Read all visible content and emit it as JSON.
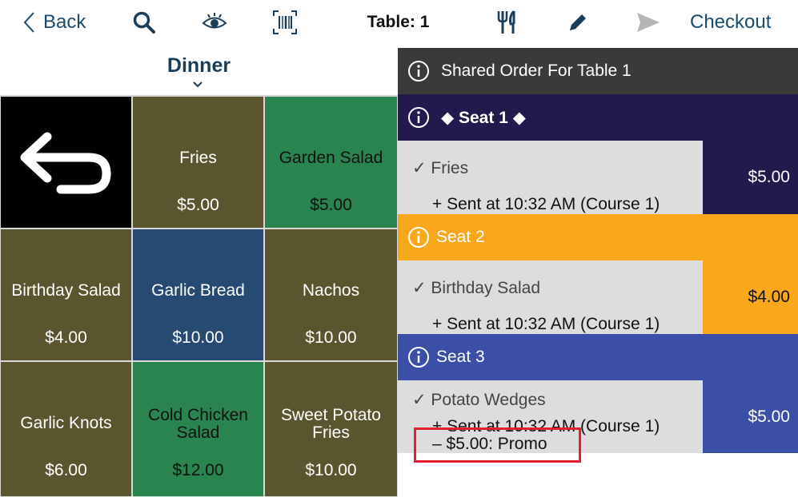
{
  "toolbar": {
    "back_label": "Back",
    "table_label": "Table: 1",
    "checkout_label": "Checkout"
  },
  "menu": {
    "title": "Dinner",
    "tiles": [
      {
        "name": "",
        "price": "",
        "color": "#000000"
      },
      {
        "name": "Fries",
        "price": "$5.00",
        "color": "#5b552f"
      },
      {
        "name": "Garden Salad",
        "price": "$5.00",
        "color": "#2a8450"
      },
      {
        "name": "Birthday Salad",
        "price": "$4.00",
        "color": "#5b552f"
      },
      {
        "name": "Garlic Bread",
        "price": "$10.00",
        "color": "#274a73"
      },
      {
        "name": "Nachos",
        "price": "$10.00",
        "color": "#5b552f"
      },
      {
        "name": "Garlic Knots",
        "price": "$6.00",
        "color": "#5b552f"
      },
      {
        "name": "Cold Chicken Salad",
        "price": "$12.00",
        "color": "#2a8450"
      },
      {
        "name": "Sweet Potato Fries",
        "price": "$10.00",
        "color": "#5b552f"
      }
    ]
  },
  "order": {
    "shared_label": "Shared Order For Table 1",
    "seats": [
      {
        "label": "◆ Seat 1 ◆",
        "color": "#211a4d",
        "item_name": "✓ Fries",
        "sent": "+ Sent at 10:32 AM (Course 1)",
        "price": "$5.00"
      },
      {
        "label": "Seat 2",
        "color": "#f9a81c",
        "item_name": "✓ Birthday Salad",
        "sent": "+ Sent at 10:32 AM (Course 1)",
        "price": "$4.00"
      },
      {
        "label": "Seat 3",
        "color": "#3b4ea8",
        "item_name": "✓ Potato Wedges",
        "sent": "+ Sent at 10:32 AM (Course 1)",
        "promo": "– $5.00: Promo",
        "price": "$5.00"
      }
    ]
  },
  "colors": {
    "accent": "#1a4a6e",
    "highlight": "#e31e2d"
  }
}
